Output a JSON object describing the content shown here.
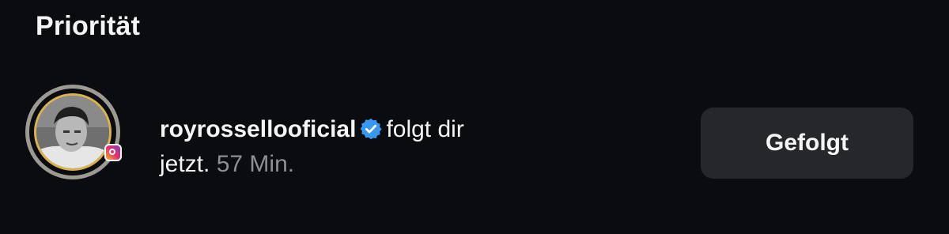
{
  "section": {
    "title": "Priorität"
  },
  "notification": {
    "username": "royrossellooficial",
    "verified_icon": "verified-badge-icon",
    "action": "folgt dir",
    "line2_prefix": "jetzt.",
    "time": "57 Min.",
    "button_label": "Gefolgt"
  },
  "colors": {
    "background": "#0b0c10",
    "text": "#f5f5f5",
    "muted": "#8e8e93",
    "button_bg": "#25272b",
    "verified_blue": "#3897f0",
    "story_ring": "#d8b44a"
  }
}
